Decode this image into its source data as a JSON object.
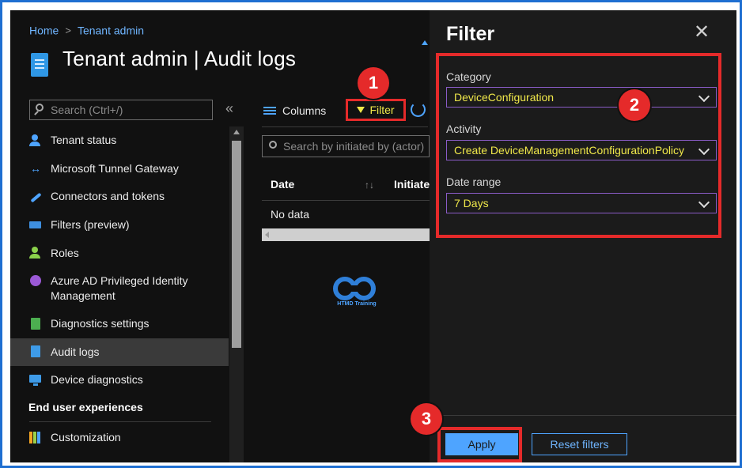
{
  "breadcrumb": {
    "home": "Home",
    "separator": ">",
    "current": "Tenant admin"
  },
  "page": {
    "title": "Tenant admin | Audit logs"
  },
  "sidebar": {
    "search_placeholder": "Search (Ctrl+/)",
    "collapse_glyph": "«",
    "items": [
      {
        "label": "Tenant status",
        "icon": "tenant-status-icon"
      },
      {
        "label": "Microsoft Tunnel Gateway",
        "icon": "tunnel-gateway-icon"
      },
      {
        "label": "Connectors and tokens",
        "icon": "connectors-icon"
      },
      {
        "label": "Filters (preview)",
        "icon": "filters-icon"
      },
      {
        "label": "Roles",
        "icon": "roles-icon"
      },
      {
        "label": "Azure AD Privileged Identity Management",
        "icon": "pim-icon"
      },
      {
        "label": "Diagnostics settings",
        "icon": "diagnostics-icon"
      },
      {
        "label": "Audit logs",
        "icon": "audit-logs-icon",
        "active": true
      },
      {
        "label": "Device diagnostics",
        "icon": "device-diagnostics-icon"
      }
    ],
    "section_title": "End user experiences",
    "section_items": [
      {
        "label": "Customization",
        "icon": "customization-icon"
      }
    ]
  },
  "toolbar": {
    "columns_label": "Columns",
    "filter_label": "Filter"
  },
  "main": {
    "search_placeholder": "Search by initiated by (actor)",
    "columns": [
      "Date",
      "Initiate"
    ],
    "sort_glyph": "↑↓",
    "empty_text": "No data"
  },
  "watermark": {
    "text": "HTMD Training"
  },
  "filter_panel": {
    "title": "Filter",
    "close_glyph": "✕",
    "fields": [
      {
        "label": "Category",
        "value": "DeviceConfiguration"
      },
      {
        "label": "Activity",
        "value": "Create DeviceManagementConfigurationPolicy"
      },
      {
        "label": "Date range",
        "value": "7 Days"
      }
    ],
    "apply_label": "Apply",
    "reset_label": "Reset filters"
  },
  "steps": [
    "1",
    "2",
    "3"
  ],
  "colors": {
    "frame": "#1f6fd1",
    "highlight": "#e52a2a",
    "accent": "#4ea4ff",
    "value_text": "#f0e84a"
  }
}
